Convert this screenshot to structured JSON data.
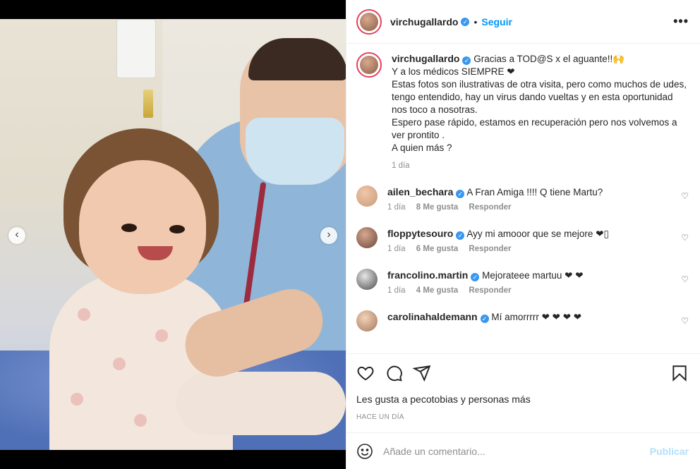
{
  "post": {
    "author": "virchugallardo",
    "follow_label": "Seguir",
    "more_label": "•••",
    "caption_lines": [
      "Gracias a TOD@S x el aguante!!🙌",
      "Y a los médicos SIEMPRE ❤",
      "Estas fotos son ilustrativas de otra visita, pero como muchos de udes, tengo entendido, hay un virus dando vueltas y en esta oportunidad nos toco a nosotras.",
      "Espero pase rápido, estamos en recuperación pero nos volvemos a ver prontito .",
      "A quien más ?"
    ],
    "caption_time": "1 día"
  },
  "comments": [
    {
      "user": "ailen_bechara",
      "text": "A Fran Amiga !!!! Q tiene Martu?",
      "time": "1 día",
      "likes": "8 Me gusta",
      "reply": "Responder"
    },
    {
      "user": "floppytesouro",
      "text": "Ayy mi amooor que se mejore ❤▯",
      "time": "1 día",
      "likes": "6 Me gusta",
      "reply": "Responder"
    },
    {
      "user": "francolino.martin",
      "text": "Mejorateee martuu ❤ ❤",
      "time": "1 día",
      "likes": "4 Me gusta",
      "reply": "Responder"
    },
    {
      "user": "carolinahaldemann",
      "text": "Mí amorrrrr ❤ ❤ ❤ ❤",
      "time": "",
      "likes": "",
      "reply": ""
    }
  ],
  "actions": {
    "liked_by": "Les gusta a pecotobias y personas más",
    "posted_ago": "HACE UN DÍA"
  },
  "add_comment": {
    "placeholder": "Añade un comentario...",
    "publish_label": "Publicar"
  },
  "nav": {
    "prev": "‹",
    "next": "›"
  },
  "icons": [
    "heart-icon",
    "comment-icon",
    "share-icon",
    "bookmark-icon",
    "emoji-icon",
    "verified-icon"
  ],
  "colors": {
    "accent": "#0095f6",
    "heart": "#ed4956",
    "publish_disabled": "#b2dffc"
  }
}
